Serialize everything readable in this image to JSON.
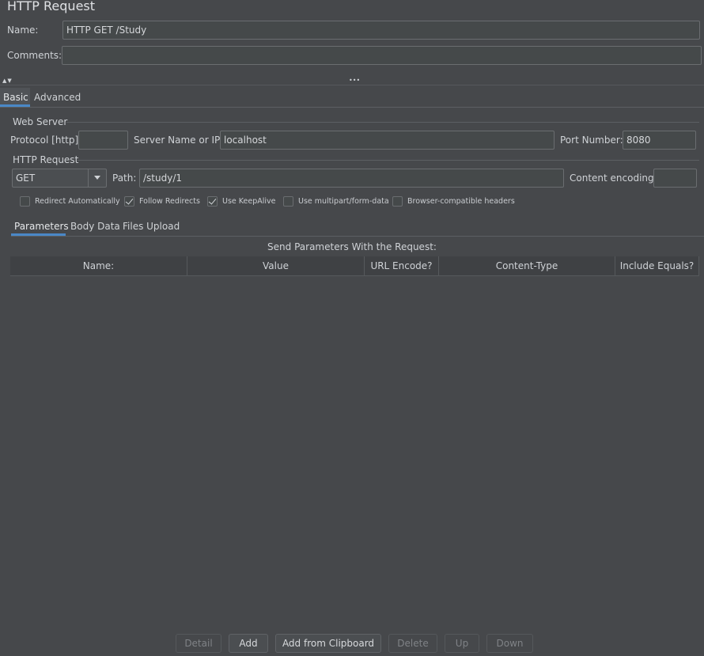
{
  "panel": {
    "title": "HTTP Request"
  },
  "name_row": {
    "label": "Name:",
    "value": "HTTP GET /Study"
  },
  "comments_row": {
    "label": "Comments:",
    "value": ""
  },
  "divider": {
    "grip": "•••",
    "collapse_arrows": "▲▼"
  },
  "tabs": {
    "basic": "Basic",
    "advanced": "Advanced"
  },
  "web_server": {
    "legend": "Web Server",
    "protocol_label": "Protocol [http]:",
    "protocol_value": "",
    "server_label": "Server Name or IP:",
    "server_value": "localhost",
    "port_label": "Port Number:",
    "port_value": "8080"
  },
  "http_request": {
    "legend": "HTTP Request",
    "method": "GET",
    "path_label": "Path:",
    "path_value": "/study/1",
    "encoding_label": "Content encoding:",
    "encoding_value": ""
  },
  "options": {
    "redirect_auto": {
      "label": "Redirect Automatically",
      "checked": false
    },
    "follow_redirects": {
      "label": "Follow Redirects",
      "checked": true
    },
    "keepalive": {
      "label": "Use KeepAlive",
      "checked": true
    },
    "multipart": {
      "label": "Use multipart/form-data",
      "checked": false
    },
    "browser_headers": {
      "label": "Browser-compatible headers",
      "checked": false
    }
  },
  "sub_tabs": {
    "parameters": "Parameters",
    "body_data": "Body Data",
    "files_upload": "Files Upload"
  },
  "params_table": {
    "caption": "Send Parameters With the Request:",
    "columns": [
      "Name:",
      "Value",
      "URL Encode?",
      "Content-Type",
      "Include Equals?"
    ]
  },
  "buttons": {
    "detail": "Detail",
    "add": "Add",
    "add_clipboard": "Add from Clipboard",
    "delete": "Delete",
    "up": "Up",
    "down": "Down"
  },
  "colors": {
    "background": "#46484b",
    "accent": "#4a88c7",
    "field": "#45494a"
  }
}
